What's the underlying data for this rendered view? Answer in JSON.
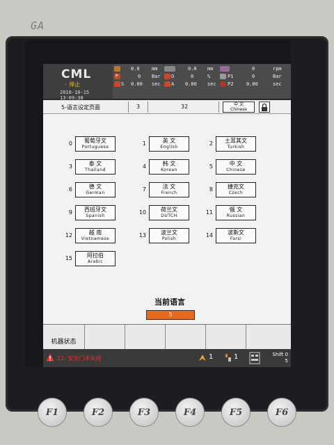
{
  "device": {
    "brand": "GA"
  },
  "header": {
    "logo": "CML",
    "status": "◦ 停止",
    "datetime": "2010-10-15 13:09:38",
    "rows": [
      {
        "a": "0.0",
        "ua": "mm",
        "b": "0.0",
        "ub": "mm",
        "c": "0",
        "uc": "rpm"
      },
      {
        "a": "0",
        "ua": "Bar",
        "b": "0",
        "ub": "%",
        "c": "0",
        "uc": "Bar"
      },
      {
        "a": "0.00",
        "ua": "sec",
        "b": "0.00",
        "ub": "sec",
        "c": "0.00",
        "uc": "sec"
      }
    ],
    "left_labels": [
      "P",
      "S"
    ],
    "mid_labels": [
      "O",
      "A"
    ],
    "right_labels": [
      "P1",
      "P2"
    ],
    "top_left_a": "0.0",
    "top_left_ua": "mm",
    "top_mid_b": "0.0"
  },
  "title_bar": {
    "page_title": "5-语言设定页面",
    "field1": "3",
    "field2": "32",
    "lang_btn_cn": "中 文",
    "lang_btn_en": "Chinese"
  },
  "languages": [
    {
      "num": "0",
      "cn": "葡萄牙文",
      "en": "Portuguese"
    },
    {
      "num": "1",
      "cn": "英 文",
      "en": "English"
    },
    {
      "num": "2",
      "cn": "土耳其文",
      "en": "Turkish"
    },
    {
      "num": "3",
      "cn": "泰 文",
      "en": "Thailand"
    },
    {
      "num": "4",
      "cn": "韩 文",
      "en": "Korean"
    },
    {
      "num": "5",
      "cn": "中 文",
      "en": "Chinese"
    },
    {
      "num": "6",
      "cn": "德 文",
      "en": "German"
    },
    {
      "num": "7",
      "cn": "法 文",
      "en": "French"
    },
    {
      "num": "8",
      "cn": "捷克文",
      "en": "Czech"
    },
    {
      "num": "9",
      "cn": "西班牙文",
      "en": "Spanish"
    },
    {
      "num": "10",
      "cn": "荷兰文",
      "en": "DUTCH"
    },
    {
      "num": "11",
      "cn": "俄 文",
      "en": "Russian"
    },
    {
      "num": "12",
      "cn": "越 南",
      "en": "Vietnamese"
    },
    {
      "num": "13",
      "cn": "波兰文",
      "en": "Polish"
    },
    {
      "num": "14",
      "cn": "波斯文",
      "en": "Farsi"
    },
    {
      "num": "15",
      "cn": "阿拉伯",
      "en": "Arabic"
    }
  ],
  "current": {
    "label": "当前语言",
    "value": "5"
  },
  "softkeys": [
    "机器状态",
    "",
    "",
    "",
    "",
    ""
  ],
  "alarm": {
    "text": "12: 安全门未关闭",
    "ind1": "1",
    "ind2": "1",
    "shift_label": "Shift 0",
    "shift_value": "5"
  },
  "fkeys": [
    "F1",
    "F2",
    "F3",
    "F4",
    "F5",
    "F6"
  ],
  "colors": {
    "current_value_bg": "#e36a1e",
    "alarm_text": "#d23838",
    "status": "#e8c12c"
  }
}
